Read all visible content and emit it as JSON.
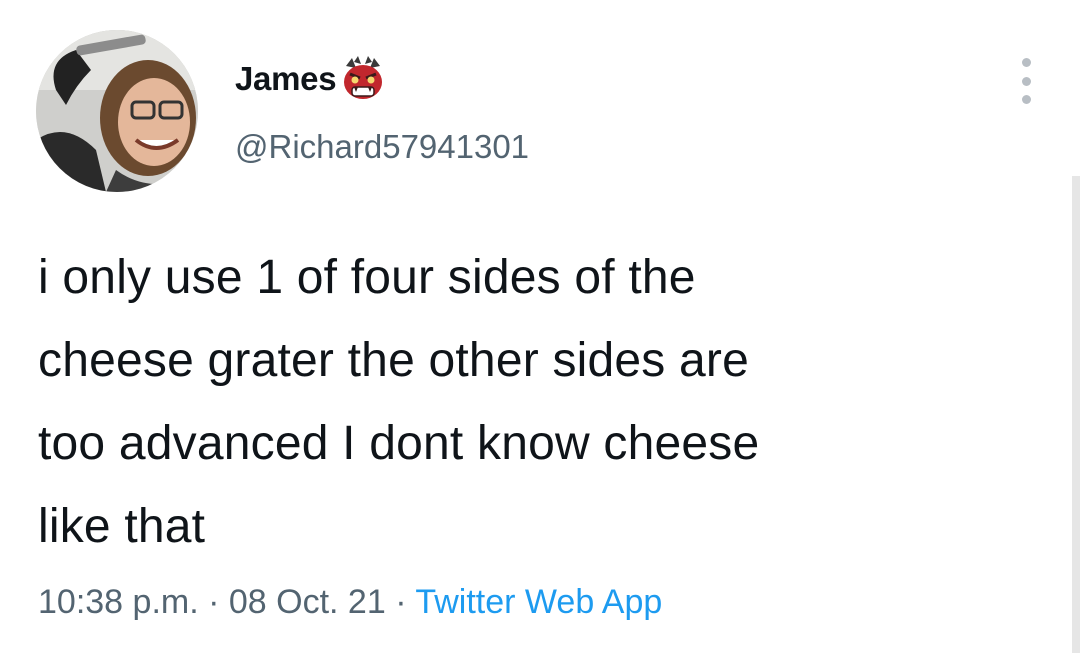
{
  "author": {
    "display_name": "James",
    "badge_icon": "ogre-mask-icon",
    "handle": "@Richard57941301"
  },
  "tweet": {
    "lines": [
      "i only use 1 of four sides of the",
      "cheese grater the other sides are",
      "too advanced I dont know cheese",
      "like that"
    ]
  },
  "meta": {
    "time": "10:38 p.m.",
    "separator": " · ",
    "date": "08 Oct. 21",
    "source": "Twitter Web App"
  },
  "colors": {
    "text": "#0f1419",
    "secondary": "#536471",
    "link": "#1d9bf0"
  }
}
